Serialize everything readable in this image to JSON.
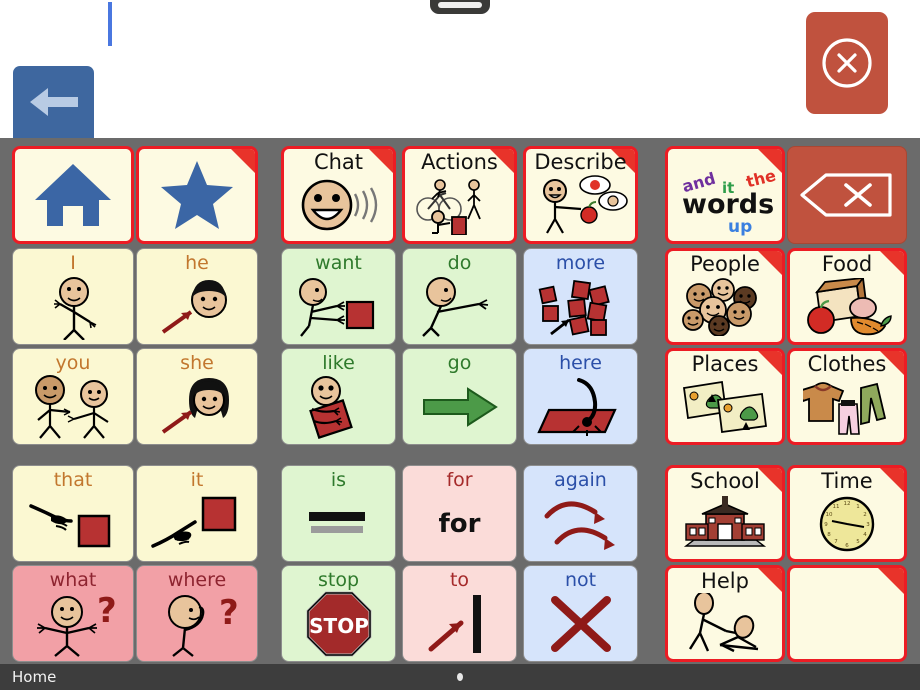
{
  "app": {
    "name": "AAC communication grid",
    "message_bar": {
      "text": "",
      "caret_visible": true
    },
    "back_button": {
      "label": "back",
      "icon": "arrow-left-icon",
      "color": "#3e679f"
    },
    "close_button": {
      "label": "close",
      "icon": "close-circle-icon",
      "color": "#c0523e"
    },
    "grabber": {
      "label": "drag-handle"
    }
  },
  "status_bar": {
    "home_label": "Home"
  },
  "colors": {
    "page_background": "#6b6b6b",
    "category_border": "#ec1c24",
    "category_fill": "#fdfae2",
    "pronoun_fill": "#fbf8d2",
    "verb_fill": "#dff5d0",
    "adverb_fill": "#d6e4fb",
    "preposition_fill": "#fbdcd9",
    "question_fill": "#f2a0a6",
    "delete_fill": "#c0523e"
  },
  "groups": {
    "left": {
      "name": "pronouns-group",
      "cells": [
        {
          "label": "",
          "icon": "home-icon",
          "kind": "cat",
          "corner": false
        },
        {
          "label": "",
          "icon": "star-icon",
          "kind": "cat",
          "corner": true
        },
        {
          "label": "I",
          "icon": "person-pointing-self-icon",
          "kind": "c-cream",
          "corner": false
        },
        {
          "label": "he",
          "icon": "boy-face-arrow-icon",
          "kind": "c-cream",
          "corner": false
        },
        {
          "label": "you",
          "icon": "two-people-pointing-icon",
          "kind": "c-cream",
          "corner": false
        },
        {
          "label": "she",
          "icon": "girl-face-arrow-icon",
          "kind": "c-cream",
          "corner": false
        },
        {
          "label": "that",
          "icon": "hand-pointing-far-icon",
          "kind": "c-cream",
          "corner": false
        },
        {
          "label": "it",
          "icon": "hand-pointing-up-icon",
          "kind": "c-cream",
          "corner": false
        },
        {
          "label": "what",
          "icon": "person-shrug-question-icon",
          "kind": "c-pink",
          "corner": false
        },
        {
          "label": "where",
          "icon": "person-looking-question-icon",
          "kind": "c-pink",
          "corner": false
        }
      ]
    },
    "middle": {
      "name": "verbs-group",
      "cells": [
        {
          "label": "Chat",
          "icon": "talking-face-icon",
          "kind": "cat",
          "corner": true
        },
        {
          "label": "Actions",
          "icon": "actions-icon",
          "kind": "cat",
          "corner": true
        },
        {
          "label": "Describe",
          "icon": "describe-icon",
          "kind": "cat",
          "corner": true
        },
        {
          "label": "want",
          "icon": "person-reaching-block-icon",
          "kind": "c-green",
          "corner": false
        },
        {
          "label": "do",
          "icon": "person-arm-out-icon",
          "kind": "c-green",
          "corner": false
        },
        {
          "label": "more",
          "icon": "many-blocks-arrow-icon",
          "kind": "c-blue",
          "corner": false
        },
        {
          "label": "like",
          "icon": "person-hugging-block-icon",
          "kind": "c-green",
          "corner": false
        },
        {
          "label": "go",
          "icon": "green-arrow-right-icon",
          "kind": "c-green",
          "corner": false
        },
        {
          "label": "here",
          "icon": "finger-on-mat-icon",
          "kind": "c-blue",
          "corner": false
        },
        {
          "label": "is",
          "icon": "equals-bar-icon",
          "kind": "c-green",
          "corner": false
        },
        {
          "label": "for",
          "icon": "text-for-icon",
          "kind": "c-pinklt",
          "corner": false,
          "art_text": "for"
        },
        {
          "label": "again",
          "icon": "two-curved-arrows-icon",
          "kind": "c-blue",
          "corner": false
        },
        {
          "label": "stop",
          "icon": "stop-sign-icon",
          "kind": "c-green",
          "corner": false,
          "art_text": "STOP"
        },
        {
          "label": "to",
          "icon": "arrow-to-bar-icon",
          "kind": "c-pinklt",
          "corner": false
        },
        {
          "label": "not",
          "icon": "red-x-icon",
          "kind": "c-blue",
          "corner": false
        }
      ]
    },
    "right": {
      "name": "categories-group",
      "cells": [
        {
          "label": "",
          "icon": "words-icon",
          "kind": "cat",
          "corner": true
        },
        {
          "label": "",
          "icon": "backspace-icon",
          "kind": "c-brick",
          "corner": false
        },
        {
          "label": "People",
          "icon": "people-faces-icon",
          "kind": "cat",
          "corner": true
        },
        {
          "label": "Food",
          "icon": "food-icon",
          "kind": "cat",
          "corner": true
        },
        {
          "label": "Places",
          "icon": "maps-icon",
          "kind": "cat",
          "corner": true
        },
        {
          "label": "Clothes",
          "icon": "clothes-icon",
          "kind": "cat",
          "corner": true
        },
        {
          "label": "School",
          "icon": "school-building-icon",
          "kind": "cat",
          "corner": true
        },
        {
          "label": "Time",
          "icon": "clock-icon",
          "kind": "cat",
          "corner": true
        },
        {
          "label": "Help",
          "icon": "helping-hand-icon",
          "kind": "cat",
          "corner": true
        },
        {
          "label": "",
          "icon": "",
          "kind": "c-empty",
          "corner": true
        }
      ]
    }
  },
  "words_cell": {
    "and": "and",
    "it": "it",
    "the": "the",
    "words": "words",
    "up": "up"
  },
  "art_labels": {
    "for": "for",
    "stop": "STOP"
  }
}
